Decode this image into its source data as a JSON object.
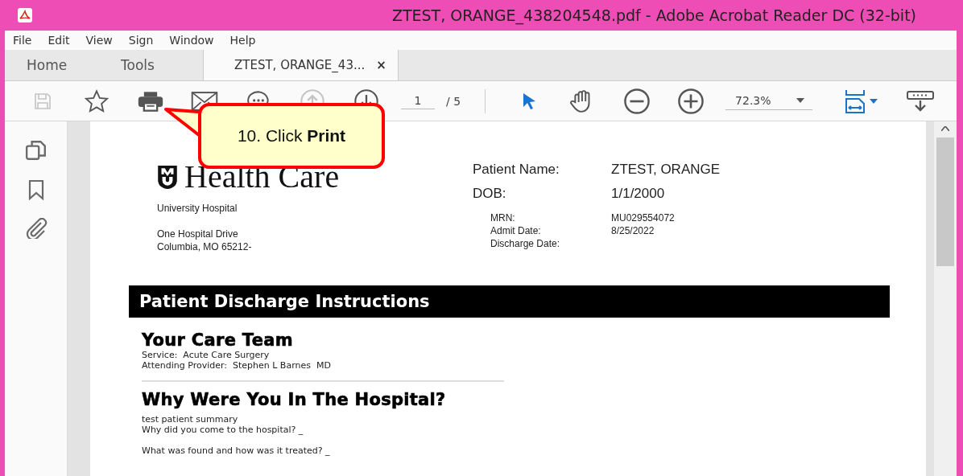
{
  "window": {
    "title": "ZTEST, ORANGE_438204548.pdf - Adobe Acrobat Reader DC (32-bit)"
  },
  "menu": [
    "File",
    "Edit",
    "View",
    "Sign",
    "Window",
    "Help"
  ],
  "tabs": [
    {
      "label": "Home",
      "kind": "nav",
      "selected": false
    },
    {
      "label": "Tools",
      "kind": "nav",
      "selected": false
    },
    {
      "label": "ZTEST, ORANGE_43...",
      "kind": "document",
      "selected": true,
      "close": "×"
    }
  ],
  "toolbar": [
    {
      "kind": "save",
      "disabled": true
    },
    {
      "kind": "star",
      "disabled": false
    },
    {
      "kind": "print",
      "disabled": false
    },
    {
      "kind": "mail",
      "disabled": false
    },
    {
      "kind": "comment",
      "disabled": false
    },
    {
      "kind": "page-up",
      "disabled": true
    },
    {
      "kind": "page-down",
      "disabled": false
    }
  ],
  "page_nav": {
    "value": "1",
    "total": "/ 5"
  },
  "tools": [
    {
      "kind": "select",
      "selected": true
    },
    {
      "kind": "hand",
      "selected": false
    },
    {
      "kind": "zoom-out",
      "selected": false
    },
    {
      "kind": "zoom-in",
      "selected": false
    }
  ],
  "zoom": {
    "value": "72.3%"
  },
  "sidebar": [
    {
      "kind": "pages"
    },
    {
      "kind": "bookmark"
    },
    {
      "kind": "attachment"
    }
  ],
  "callout": {
    "text": "10. Click **Print**"
  },
  "document": {
    "logo_text": "Health Care",
    "hospital": "University Hospital",
    "address": [
      "One Hospital Drive",
      "Columbia, MO 65212-"
    ],
    "main_fields": [
      {
        "label": "Patient Name:",
        "value": "ZTEST, ORANGE"
      },
      {
        "label": "DOB:",
        "value": "1/1/2000"
      }
    ],
    "sub_fields": [
      {
        "label": "MRN:",
        "value": "MU029554072"
      },
      {
        "label": "Admit Date:",
        "value": "8/25/2022"
      },
      {
        "label": "Discharge Date:"
      }
    ],
    "banner": "Patient Discharge Instructions",
    "sections": [
      {
        "heading": "Your Care Team",
        "paragraphs": [
          [
            "Service:  Acute Care Surgery",
            "Attending Provider:  Stephen L Barnes  MD"
          ]
        ]
      },
      {
        "heading": "Why Were You In The Hospital?",
        "paragraphs": [
          [
            "test patient summary",
            "Why did you come to the hospital? _"
          ],
          [
            "What was found and how was it treated? _"
          ]
        ]
      }
    ]
  }
}
